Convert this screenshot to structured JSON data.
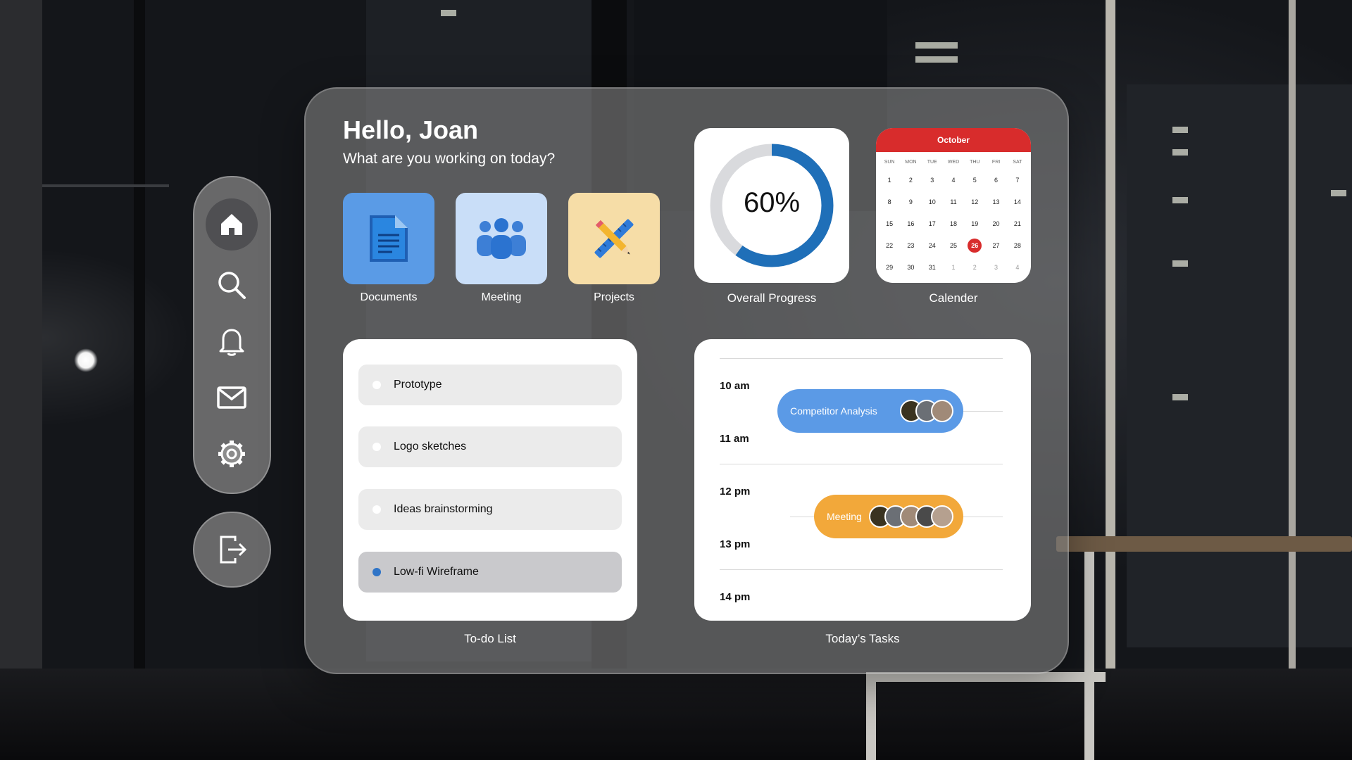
{
  "header": {
    "greeting": "Hello, Joan",
    "subtitle": "What are you working on today?"
  },
  "apps": [
    {
      "label": "Documents",
      "color": "#5a9be6",
      "icon": "document-icon"
    },
    {
      "label": "Meeting",
      "color": "#c9def8",
      "icon": "people-icon"
    },
    {
      "label": "Projects",
      "color": "#f6dda7",
      "icon": "pencil-ruler-icon"
    }
  ],
  "progress": {
    "value": 0.6,
    "label": "60%",
    "caption": "Overall Progress",
    "colors": {
      "fill": "#1f6fb8",
      "track": "#d9dadd"
    }
  },
  "calendar": {
    "month": "October",
    "caption": "Calender",
    "weekdays": [
      "SUN",
      "MON",
      "TUE",
      "WED",
      "THU",
      "FRI",
      "SAT"
    ],
    "days": [
      "1",
      "2",
      "3",
      "4",
      "5",
      "6",
      "7",
      "8",
      "9",
      "10",
      "11",
      "12",
      "13",
      "14",
      "15",
      "16",
      "17",
      "18",
      "19",
      "20",
      "21",
      "22",
      "23",
      "24",
      "25",
      "26",
      "27",
      "28",
      "29",
      "30",
      "31",
      "1",
      "2",
      "3",
      "4"
    ],
    "today": "26",
    "accent": "#d82c2c"
  },
  "todo": {
    "caption": "To-do List",
    "items": [
      {
        "label": "Prototype",
        "done": false
      },
      {
        "label": "Logo sketches",
        "done": false
      },
      {
        "label": "Ideas brainstorming",
        "done": false
      },
      {
        "label": "Low-fi Wireframe",
        "done": true
      }
    ]
  },
  "tasks": {
    "caption": "Today’s Tasks",
    "times": [
      "10 am",
      "11 am",
      "12 pm",
      "13 pm",
      "14 pm"
    ],
    "events": [
      {
        "name": "Competitor Analysis",
        "color": "#5b9ae6"
      },
      {
        "name": "Meeting",
        "color": "#f2a83a"
      }
    ]
  },
  "sidebar": {
    "items": [
      {
        "name": "home",
        "icon": "home-icon",
        "active": true
      },
      {
        "name": "search",
        "icon": "search-icon",
        "active": false
      },
      {
        "name": "notifications",
        "icon": "bell-icon",
        "active": false
      },
      {
        "name": "mail",
        "icon": "mail-icon",
        "active": false
      },
      {
        "name": "settings",
        "icon": "gear-icon",
        "active": false
      }
    ],
    "logout_icon": "logout-icon"
  }
}
